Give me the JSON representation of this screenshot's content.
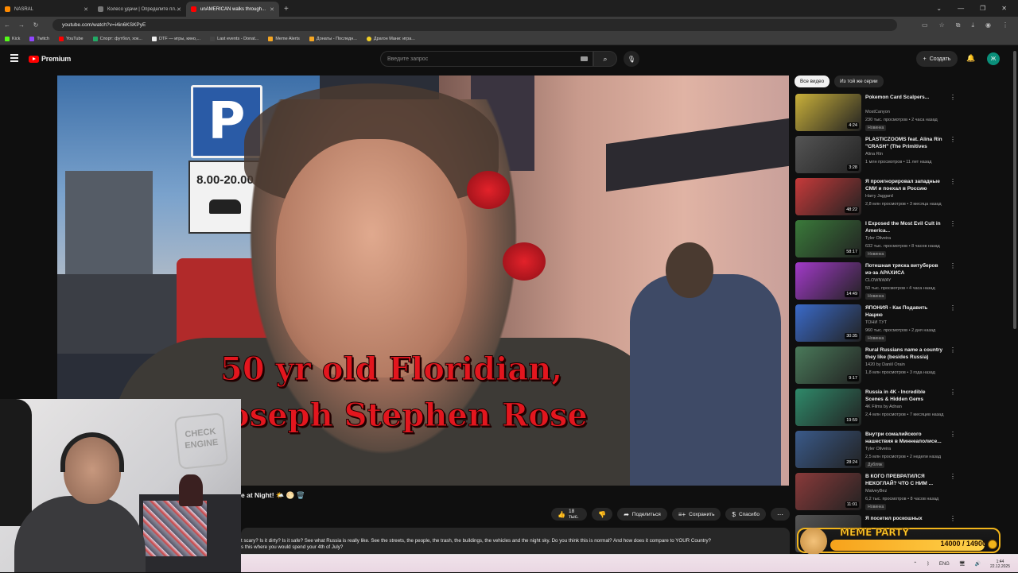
{
  "browser": {
    "tabs": [
      {
        "label": "NASRAL",
        "color": "#ff8a00"
      },
      {
        "label": "Колесо удачи | Определите пл...",
        "color": "#777777"
      },
      {
        "label": "unAMERICAN walks through...",
        "color": "#ff0000"
      }
    ],
    "url": "youtube.com/watch?v=i4in6KSKPyE",
    "bookmarks": [
      {
        "label": "Kick",
        "color": "#53fc18"
      },
      {
        "label": "Twitch",
        "color": "#9146ff"
      },
      {
        "label": "YouTube",
        "color": "#ff0000"
      },
      {
        "label": "Спорт: футбол, хок...",
        "color": "#2a6"
      },
      {
        "label": "DTF — игры, кино,...",
        "color": "#eee"
      },
      {
        "label": "Last events - Donat...",
        "color": "#444"
      },
      {
        "label": "Meme Alerts",
        "color": "#f5a623"
      },
      {
        "label": "Донаты - Последн...",
        "color": "#f5a623"
      },
      {
        "label": "Драгон Мани: игра...",
        "color": "#f2d024"
      }
    ]
  },
  "youtube": {
    "brand": "Premium",
    "search_placeholder": "Введите запрос",
    "create_label": "Создать",
    "avatar_letter": "Ж"
  },
  "video": {
    "caption_line1": "50 yr old Floridian,",
    "caption_line2": "oseph Stephen Rose",
    "sign_letter": "P",
    "sign_hours": "8.00-20.00",
    "title_fragment": "e at Night! 🌤️ 🌕 🗑️",
    "actions": {
      "likes": "18 тыс.",
      "share": "Поделиться",
      "save": "Сохранить",
      "thanks": "Спасибо"
    },
    "description_line1": "t scary? Is it dirty? Is it safe? See what Russia is really like. See the streets, the people, the trash, the buildings, the vehicles and the night sky. Do you think this is normal? And how does it compare to YOUR Country?",
    "description_line2": "s this where you would spend your 4th of July?"
  },
  "sidebar": {
    "chips": [
      "Все видео",
      "Из той же серии"
    ],
    "items": [
      {
        "title": "Pokemon Card Scalpers...",
        "channel": "MostCanyon",
        "meta": "230 тыс. просмотров • 2 часа назад",
        "badge": "Новинка",
        "duration": "4:24",
        "thumb": "#c9b03a"
      },
      {
        "title": "PLASTICZOOMS feat. Alina Rin \"CRASH\" (The Primitives Cover)",
        "channel": "Alina Rin",
        "meta": "1 млн просмотров • 11 лет назад",
        "badge": "",
        "duration": "3:28",
        "thumb": "#555555"
      },
      {
        "title": "Я проигнорировал западные СМИ и поехал в Россию",
        "channel": "Harry Jaggard",
        "meta": "2,8 млн просмотров • 3 месяца назад",
        "badge": "",
        "duration": "48:22",
        "thumb": "#c73a3a"
      },
      {
        "title": "I Exposed the Most Evil Cult in America...",
        "channel": "Tyler Oliveira",
        "meta": "632 тыс. просмотров • 8 часов назад",
        "badge": "Новинка",
        "duration": "58:17",
        "thumb": "#3a7a3a"
      },
      {
        "title": "Потешная тряска витуберов из-за АРАХИСА",
        "channel": "CLOWNWAY",
        "meta": "50 тыс. просмотров • 4 часа назад",
        "badge": "Новинка",
        "duration": "14:49",
        "thumb": "#a23ac9"
      },
      {
        "title": "ЯПОНИЯ - Как Подавить Нацию",
        "channel": "ТОНИ ТУТ",
        "meta": "960 тыс. просмотров • 2 дня назад",
        "badge": "Новинка",
        "duration": "30:35",
        "thumb": "#3a6ac9"
      },
      {
        "title": "Rural Russians name a country they like (besides Russia)",
        "channel": "1420 by Daniil Orain",
        "meta": "1,8 млн просмотров • 3 года назад",
        "badge": "",
        "duration": "9:17",
        "thumb": "#4a7a5a"
      },
      {
        "title": "Russia in 4K - Incredible Scenes & Hidden Gems",
        "channel": "4K Films by Adnan",
        "meta": "2,4 млн просмотров • 7 месяцев назад",
        "badge": "",
        "duration": "19:59",
        "thumb": "#2f8a6a"
      },
      {
        "title": "Внутри сомалийского нашествия в Миннеаполисе...",
        "channel": "Tyler Oliveira",
        "meta": "2,5 млн просмотров • 2 недели назад",
        "badge": "Дубляж",
        "duration": "28:24",
        "thumb": "#3a5a8a"
      },
      {
        "title": "В КОГО ПРЕВРАТИЛСЯ НЕКОГЛАЙ? ЧТО С НИМ ...",
        "channel": "MatveyBez",
        "meta": "6,2 тыс. просмотров • 8 часов назад",
        "badge": "Новинка",
        "duration": "11:01",
        "thumb": "#8a3a3a"
      },
      {
        "title": "Я посетил роскошных",
        "channel": "",
        "meta": "",
        "badge": "",
        "duration": "",
        "thumb": "#555555"
      }
    ]
  },
  "webcam": {
    "neon_text": "CHECK ENGINE"
  },
  "overlay": {
    "title": "MEME PARTY",
    "progress_text": "14000 / 14900",
    "progress": 0.94
  },
  "taskbar": {
    "lang": "ENG",
    "time": "1:44",
    "date": "22.12.2025"
  }
}
